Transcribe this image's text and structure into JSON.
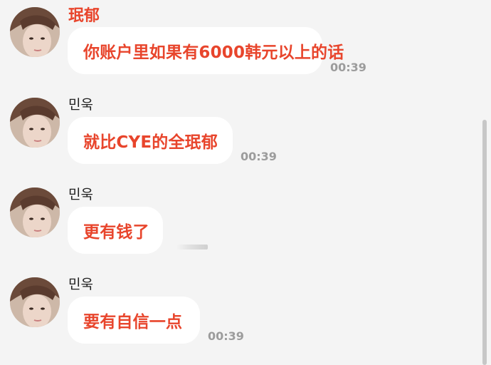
{
  "messages": [
    {
      "sender": "珉郁",
      "text": "你账户里如果有6000韩元以上的话",
      "time": "00:39"
    },
    {
      "sender": "민욱",
      "text": "就比CYE的全珉郁",
      "time": "00:39"
    },
    {
      "sender": "민욱",
      "text": "更有钱了",
      "time": ""
    },
    {
      "sender": "민욱",
      "text": "要有自信一点",
      "time": "00:39"
    }
  ],
  "colors": {
    "accent": "#e8452c",
    "background": "#f4f4f4",
    "bubble": "#ffffff",
    "timestamp": "#9c9c9c"
  }
}
